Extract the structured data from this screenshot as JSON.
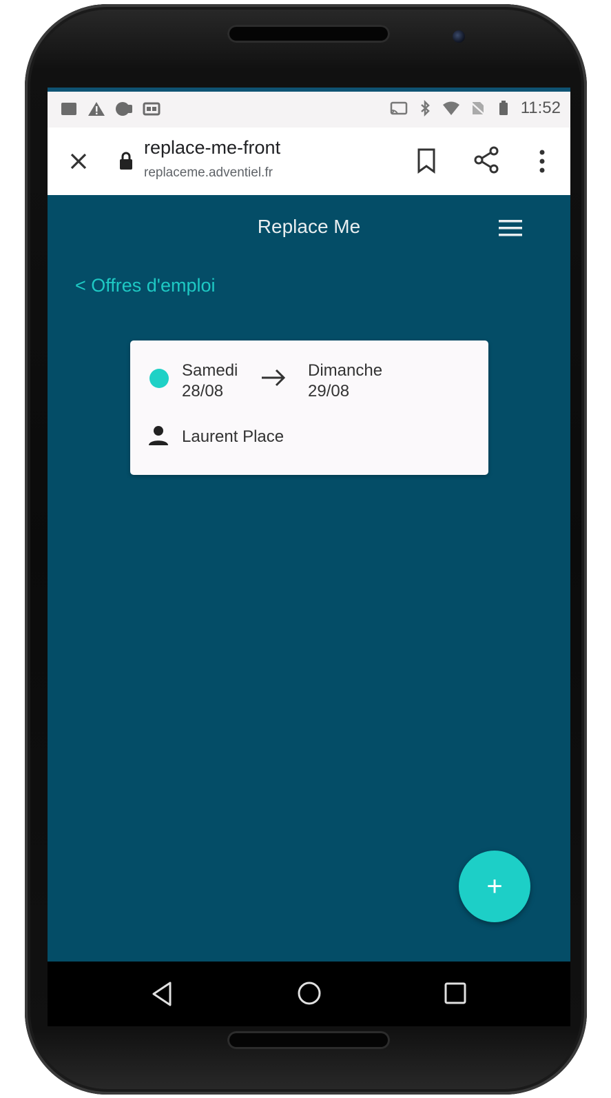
{
  "status_bar": {
    "time": "11:52"
  },
  "browser": {
    "page_title": "replace-me-front",
    "url": "replaceme.adventiel.fr"
  },
  "app": {
    "title": "Replace Me",
    "back_link": "< Offres d'emploi"
  },
  "card": {
    "start_day": "Samedi",
    "start_date": "28/08",
    "end_day": "Dimanche",
    "end_date": "29/08",
    "person_name": "Laurent Place",
    "status_color": "#1fd1c6"
  },
  "fab": {
    "label": "+"
  },
  "colors": {
    "app_background": "#044d67",
    "accent": "#1dcfc7"
  }
}
